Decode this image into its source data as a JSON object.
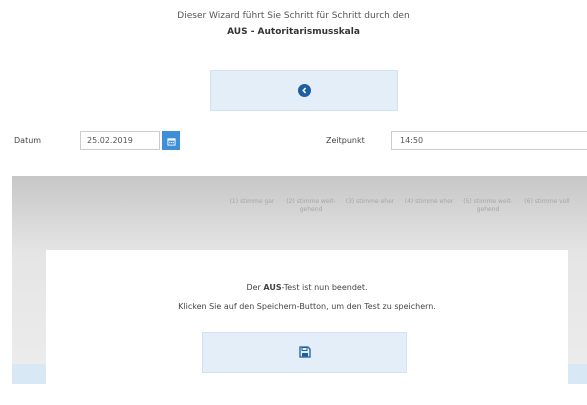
{
  "intro": {
    "line1": "Dieser Wizard führt Sie Schritt für Schritt durch den",
    "test_name": "AUS - Autoritarismusskala"
  },
  "form": {
    "date_label": "Datum",
    "date_value": "25.02.2019",
    "time_label": "Zeitpunkt",
    "time_value": "14:50"
  },
  "choices": [
    {
      "label": "(1) stimme gar"
    },
    {
      "label": "(2) stimme weit- gehend"
    },
    {
      "label": "(3) stimme eher"
    },
    {
      "label": "(4) stimme eher"
    },
    {
      "label": "(5) stimme weit- gehend"
    },
    {
      "label": "(6) stimme voll"
    }
  ],
  "completion": {
    "prefix": "Der ",
    "test_abbr": "AUS",
    "suffix": "-Test ist nun beendet.",
    "instruction": "Klicken Sie auf den Speichern-Button, um den Test zu speichern."
  },
  "icons": {
    "back": "chevron-left-circle-icon",
    "calendar": "calendar-icon",
    "save": "floppy-disk-icon"
  },
  "colors": {
    "button_bg": "#e3eef9",
    "icon_blue": "#1f5f9e",
    "calendar_bg": "#3f8fd8"
  }
}
